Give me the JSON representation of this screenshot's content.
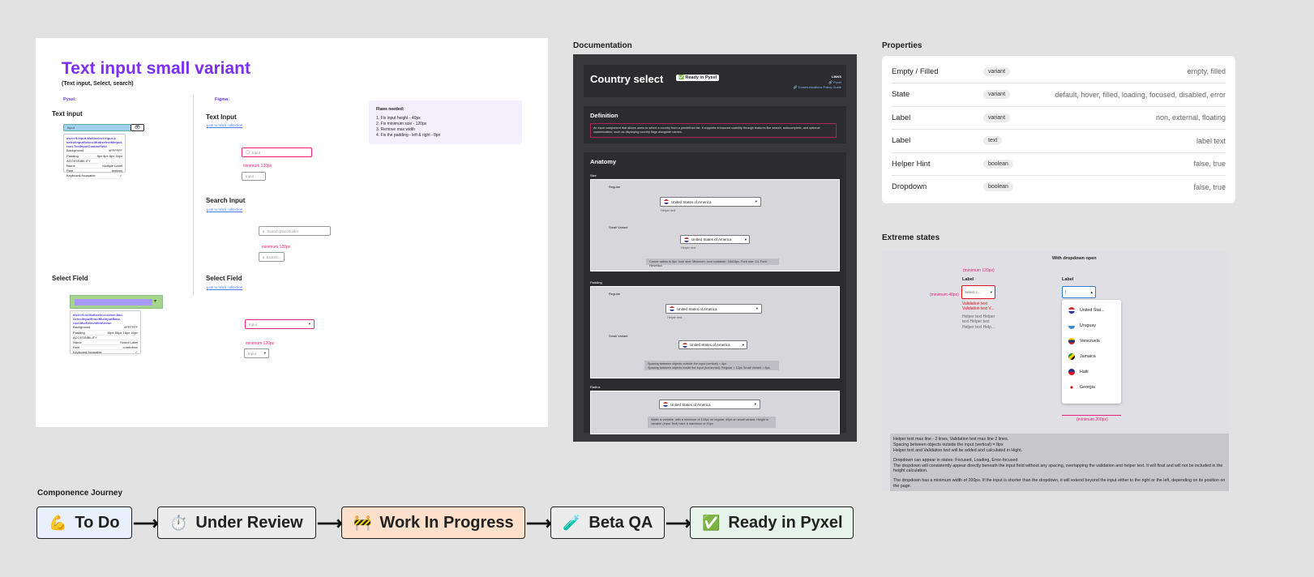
{
  "left": {
    "title": "Text input small variant",
    "subtitle": "(Text input, Select, search)",
    "pyxel_label": "Pyxel:",
    "figma_label": "Figma:",
    "text_input_left": "Text input",
    "select_field_left": "Select Field",
    "text_input_right": "Text Input",
    "search_input_right": "Search Input",
    "select_field_right": "Select Field",
    "link_text": "Link to track collection",
    "input_placeholder": "Input",
    "search_placeholder": "Search placeholder",
    "search_small": "Search...",
    "select_placeholder": "Input",
    "minimum_label": "minimum 120px",
    "flaws_title": "Flaws needed:",
    "flaws": [
      "1. Fix input height - 40px",
      "2. Fix minimum size - 120px",
      "3. Remove max width",
      "4. Fix the padding - left & right - 8px"
    ],
    "spec_text_input": {
      "head": "div#<tf-input:Multiselect input & selectInputSelect.MultiselectMinput-root.TextInputComboField",
      "rows": [
        [
          "Background",
          "#FFFFFF"
        ],
        [
          "Padding",
          "8px 8px 8px 16px"
        ],
        [
          "ACCESSIBILITY",
          ""
        ],
        [
          "Name",
          "Multiple Label"
        ],
        [
          "Role",
          "textbox"
        ],
        [
          "Keyboard-focusable",
          "✓"
        ]
      ]
    },
    "spec_select": {
      "head": "div#<tf-id-Multiselect-select.Mui-SelectInputRoot.MuiInputBase-root.MuiSelectWithUnion",
      "rows": [
        [
          "Background",
          "#FFFFFF"
        ],
        [
          "Padding",
          "16px 56px 16px 16px"
        ],
        [
          "ACCESSIBILITY",
          ""
        ],
        [
          "Name",
          "Select Label"
        ],
        [
          "Role",
          "combobox"
        ],
        [
          "Keyboard-focusable",
          "✓"
        ]
      ]
    }
  },
  "documentation": {
    "section_label": "Documentation",
    "title": "Country select",
    "badge": "✅ Ready in Pyxel",
    "links_label": "LINKS",
    "link1": "🔗 Pyxel",
    "link2": "🔗 Communications Policy Guide",
    "definition_title": "Definition",
    "definition_text": "An input component that allows users to select a country from a predefined list. It supports enhanced usability through features like search, autocomplete, and optional customization, such as displaying country flags alongside names.",
    "anatomy_title": "Anatomy",
    "size_label": "Size",
    "padding_label": "Padding",
    "radius_label": "Radius",
    "regular_label": "Regular",
    "small_variant_label": "Small Variant",
    "country": "United States of America",
    "helper_text": "Helper text",
    "corner_note": "Corner radius is 8px. Icon size: Minimum. Icon container: 16x16px. Font size: 14. Font: Helvetica",
    "spacing_note_1": "Spacing between objects outside the input (vertical) = 4px",
    "spacing_note_2": "Spacing between objects inside the input (horizontal): Regular = 12px Small Variant = 8px",
    "width_note": "Width is variable, with a minimum of 120px on regular, 40px on small variant. Height is variable (Input Text) have a maximum of 40px"
  },
  "properties": {
    "section_label": "Properties",
    "rows": [
      {
        "name": "Empty / Filled",
        "tag": "variant",
        "values": "empty, filled"
      },
      {
        "name": "State",
        "tag": "variant",
        "values": "default, hover, filled, loading, focused, disabled, error"
      },
      {
        "name": "Label",
        "tag": "variant",
        "values": "non, external, floating"
      },
      {
        "name": "Label",
        "tag": "text",
        "values": "label text"
      },
      {
        "name": "Helper Hint",
        "tag": "boolean",
        "values": "false, true"
      },
      {
        "name": "Dropdown",
        "tag": "boolean",
        "values": "false, true"
      }
    ]
  },
  "extreme": {
    "section_label": "Extreme states",
    "with_dropdown_open": "With dropdown open",
    "label": "Label",
    "select_placeholder": "Select c...",
    "minimum_120": "(minimum 120px)",
    "minimum_40": "(minimum 40px)",
    "minimum_200": "(minimum 200px)",
    "validation_1": "Validation text",
    "validation_2": "Validation text V...",
    "helper_1": "Helper text Helper",
    "helper_2": "text Helper text",
    "helper_3": "Helper text Help...",
    "countries": [
      "United Stat...",
      "Uruguay",
      "Venezuela",
      "Jamaica",
      "Haiti",
      "Georgia"
    ],
    "note_lines": [
      "Helper text max line - 2 lines, Validation text max line 2 lines.",
      "Spacing between objects outside the input (vertical) = 8px",
      "Helper text and Validation text will be added and calculated in Hight.",
      "",
      "Dropdown can appear in states: Focused, Loading, Error-focused",
      "The dropdown will consistently appear directly beneath the input field without any spacing, overlapping the validation and helper text. It will float and will not be included in the height calculation.",
      "",
      "The dropdown has a minimum width of 200px. If the input is shorter than the dropdown, it will extend beyond the input either to the right or the left, depending on its position on the page."
    ]
  },
  "journey": {
    "section_label": "Componence Journey",
    "steps": [
      {
        "emoji": "💪",
        "label": "To Do",
        "bg": "#e8f1fb"
      },
      {
        "emoji": "⏱️",
        "label": "Under Review",
        "bg": "#ececec"
      },
      {
        "emoji": "🚧",
        "label": "Work In Progress",
        "bg": "#fde0cc"
      },
      {
        "emoji": "🧪",
        "label": "Beta QA",
        "bg": "#ececec"
      },
      {
        "emoji": "✅",
        "label": "Ready in Pyxel",
        "bg": "#e6f4ec"
      }
    ]
  }
}
